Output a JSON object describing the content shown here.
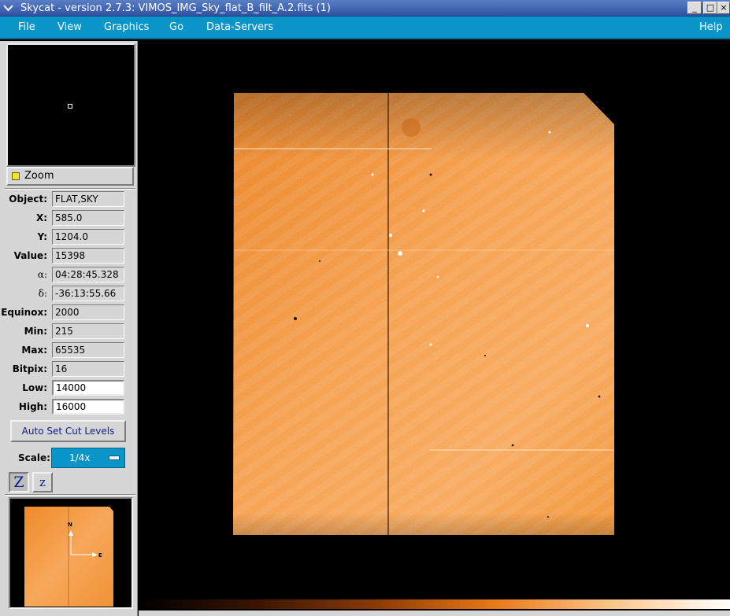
{
  "window": {
    "title": "Skycat - version 2.7.3: VIMOS_IMG_Sky_flat_B_filt_A.2.fits (1)",
    "menu_icon": "chevron-down-icon",
    "minimize_glyph": "_",
    "maximize_glyph": "□",
    "close_glyph": "×"
  },
  "menubar": {
    "file": "File",
    "view": "View",
    "graphics": "Graphics",
    "go": "Go",
    "data_servers": "Data-Servers",
    "help": "Help"
  },
  "zoom": {
    "label": "Zoom",
    "indicator_color": "#ffea00"
  },
  "info": [
    {
      "label": "Object:",
      "value": "FLAT,SKY"
    },
    {
      "label": "X:",
      "value": "585.0"
    },
    {
      "label": "Y:",
      "value": "1204.0"
    },
    {
      "label": "Value:",
      "value": "15398"
    },
    {
      "label": "α:",
      "value": "04:28:45.328"
    },
    {
      "label": "δ:",
      "value": "-36:13:55.66"
    },
    {
      "label": "Equinox:",
      "value": "2000"
    },
    {
      "label": "Min:",
      "value": "215"
    },
    {
      "label": "Max:",
      "value": "65535"
    },
    {
      "label": "Bitpix:",
      "value": "16"
    },
    {
      "label": "Low:",
      "value": "14000"
    },
    {
      "label": "High:",
      "value": "16000"
    }
  ],
  "auto_cut_label": "Auto Set Cut Levels",
  "scale": {
    "label": "Scale:",
    "value": "1/4x"
  },
  "zoom_in_glyph": "Z",
  "zoom_out_glyph": "z",
  "compass": {
    "north": "N",
    "east": "E"
  },
  "colors": {
    "menubar": "#0a95c8",
    "image_orange": "#f08c2c",
    "panel": "#d6d6d6"
  }
}
